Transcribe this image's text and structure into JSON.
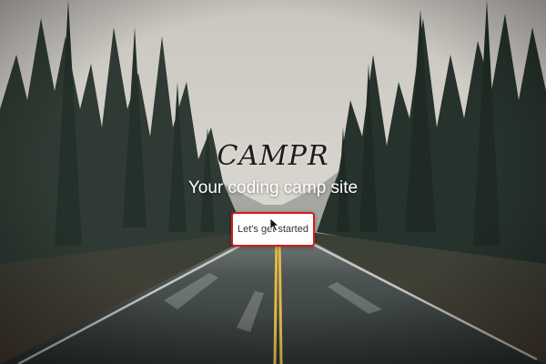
{
  "hero": {
    "title": "CAMPR",
    "subtitle": "Your coding camp site",
    "cta_label": "Let's get started",
    "cta_border_color": "#d81b1b"
  },
  "background": {
    "description_icon": "forest-road-photo",
    "sky_color": "#d7d3cd",
    "forest_color": "#2f3a33",
    "road_color": "#3f4646",
    "centerline_color": "#e1b84a"
  },
  "cursor": {
    "icon": "arrow-pointer-icon"
  }
}
